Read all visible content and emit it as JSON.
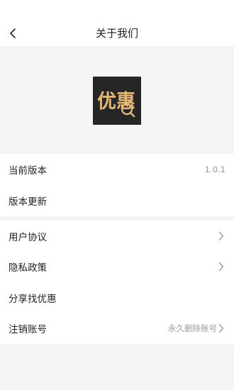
{
  "header": {
    "title": "关于我们"
  },
  "logo": {
    "text": "优惠",
    "bg_color": "#262626",
    "text_color": "#e7b776"
  },
  "info_section": {
    "current_version_label": "当前版本",
    "current_version_value": "1.0.1",
    "update_label": "版本更新"
  },
  "links_section": {
    "user_agreement_label": "用户协议",
    "privacy_policy_label": "隐私政策",
    "share_label": "分享找优惠",
    "cancel_account_label": "注销账号",
    "cancel_account_value": "永久删除账号"
  },
  "colors": {
    "background": "#f5f5f5",
    "card": "#ffffff",
    "secondary_text": "#9a9a9a",
    "chevron": "#8c8c8c"
  },
  "icons": {
    "back": "chevron-left-icon",
    "row_arrow": "chevron-right-icon"
  }
}
